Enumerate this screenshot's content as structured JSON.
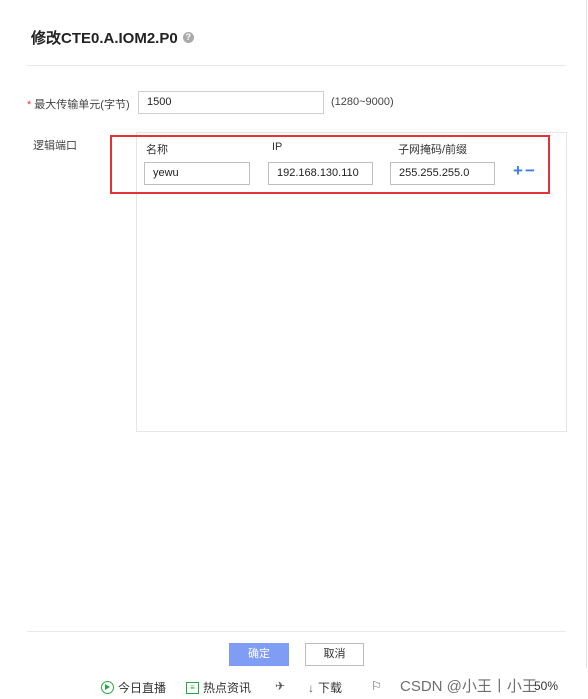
{
  "dialog": {
    "title": "修改CTE0.A.IOM2.P0",
    "help_icon": "?"
  },
  "mtu": {
    "required_mark": "*",
    "label": "最大传输单元(字节)",
    "value": "1500",
    "range": "(1280~9000)"
  },
  "logical_port": {
    "label": "逻辑端口",
    "columns": {
      "name": "名称",
      "ip": "IP",
      "mask": "子网掩码/前缀"
    },
    "row": {
      "name": "yewu",
      "ip": "192.168.130.110",
      "mask": "255.255.255.0"
    },
    "add_icon": "+",
    "remove_icon": "−",
    "highlight_color": "#e53238"
  },
  "footer": {
    "ok_label": "确定",
    "cancel_label": "取消"
  },
  "taskbar": {
    "items": [
      {
        "icon": "play-circle-icon",
        "label": "今日直播"
      },
      {
        "icon": "news-icon",
        "label": "热点资讯"
      },
      {
        "icon": "pin-icon",
        "label": ""
      },
      {
        "icon": "download-arrow-icon",
        "label": "下载"
      },
      {
        "icon": "flag-icon",
        "label": ""
      }
    ],
    "watermark": "CSDN @小王丨小王",
    "zoom": "50%"
  },
  "colors": {
    "primary_button": "#7f9df5",
    "link_blue": "#3d7fe8",
    "required_red": "#e4393c"
  }
}
